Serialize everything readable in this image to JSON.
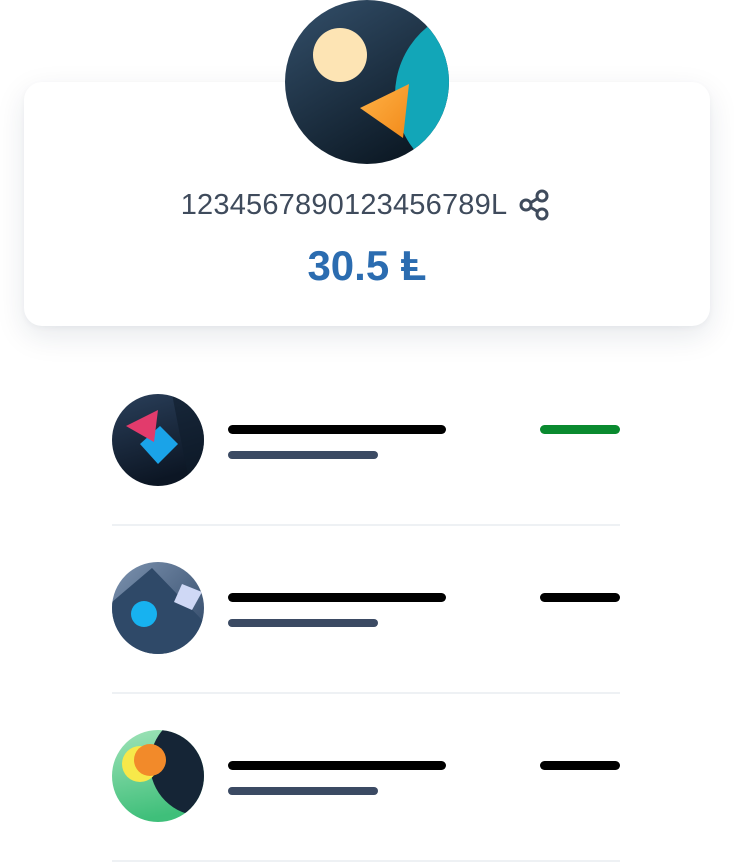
{
  "account": {
    "address": "1234567890123456789L",
    "balance": "30.5 Ⱡ",
    "avatar_icon": "account-avatar-icon",
    "share_icon": "share-icon"
  },
  "colors": {
    "balance": "#2b6cb0",
    "incoming_amount": "#0a8a2f",
    "outgoing_amount": "#000000",
    "title_placeholder": "#000000",
    "subtitle_placeholder": "#3b4a63",
    "divider": "#eef1f4"
  },
  "transactions": [
    {
      "avatar_icon": "transaction-avatar-icon",
      "direction": "incoming"
    },
    {
      "avatar_icon": "transaction-avatar-icon",
      "direction": "outgoing"
    },
    {
      "avatar_icon": "transaction-avatar-icon",
      "direction": "outgoing"
    }
  ]
}
